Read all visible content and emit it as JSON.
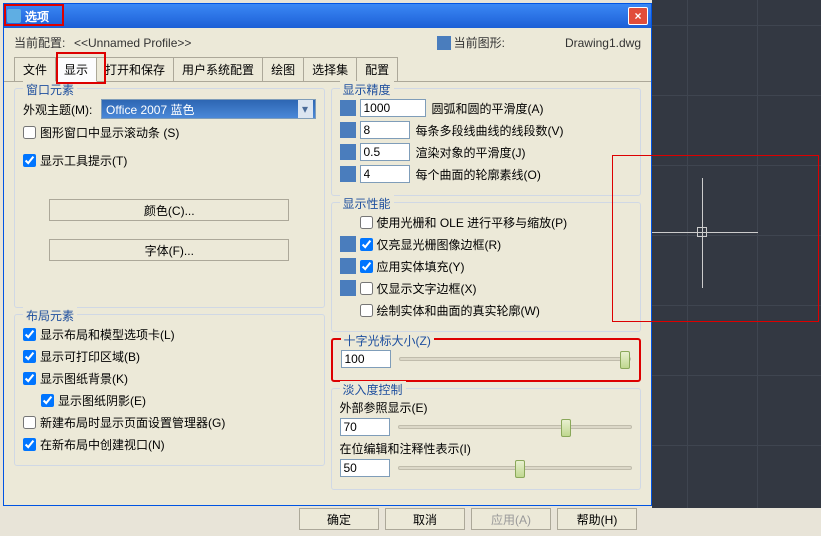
{
  "titlebar": {
    "title": "选项"
  },
  "profile": {
    "current_label": "当前配置:",
    "current_val": "<<Unnamed Profile>>",
    "drawing_label": "当前图形:",
    "drawing_val": "Drawing1.dwg"
  },
  "tabs": [
    "文件",
    "显示",
    "打开和保存",
    "用户系统配置",
    "绘图",
    "选择集",
    "配置"
  ],
  "window_elements": {
    "title": "窗口元素",
    "theme_label": "外观主题(M):",
    "theme_val": "Office 2007 蓝色",
    "scroll": "图形窗口中显示滚动条 (S)",
    "tooltip": "显示工具提示(T)",
    "color_btn": "颜色(C)...",
    "font_btn": "字体(F)..."
  },
  "layout": {
    "title": "布局元素",
    "l1": "显示布局和模型选项卡(L)",
    "l2": "显示可打印区域(B)",
    "l3": "显示图纸背景(K)",
    "l4": "显示图纸阴影(E)",
    "l5": "新建布局时显示页面设置管理器(G)",
    "l6": "在新布局中创建视口(N)"
  },
  "precision": {
    "title": "显示精度",
    "p1_val": "1000",
    "p1_lbl": "圆弧和圆的平滑度(A)",
    "p2_val": "8",
    "p2_lbl": "每条多段线曲线的线段数(V)",
    "p3_val": "0.5",
    "p3_lbl": "渲染对象的平滑度(J)",
    "p4_val": "4",
    "p4_lbl": "每个曲面的轮廓素线(O)"
  },
  "performance": {
    "title": "显示性能",
    "f1": "使用光栅和 OLE 进行平移与缩放(P)",
    "f2": "仅亮显光栅图像边框(R)",
    "f3": "应用实体填充(Y)",
    "f4": "仅显示文字边框(X)",
    "f5": "绘制实体和曲面的真实轮廓(W)"
  },
  "crosshair": {
    "title": "十字光标大小(Z)",
    "val": "100"
  },
  "fade": {
    "title": "淡入度控制",
    "xref_lbl": "外部参照显示(E)",
    "xref_val": "70",
    "inplace_lbl": "在位编辑和注释性表示(I)",
    "inplace_val": "50"
  },
  "buttons": {
    "ok": "确定",
    "cancel": "取消",
    "apply": "应用(A)",
    "help": "帮助(H)"
  }
}
